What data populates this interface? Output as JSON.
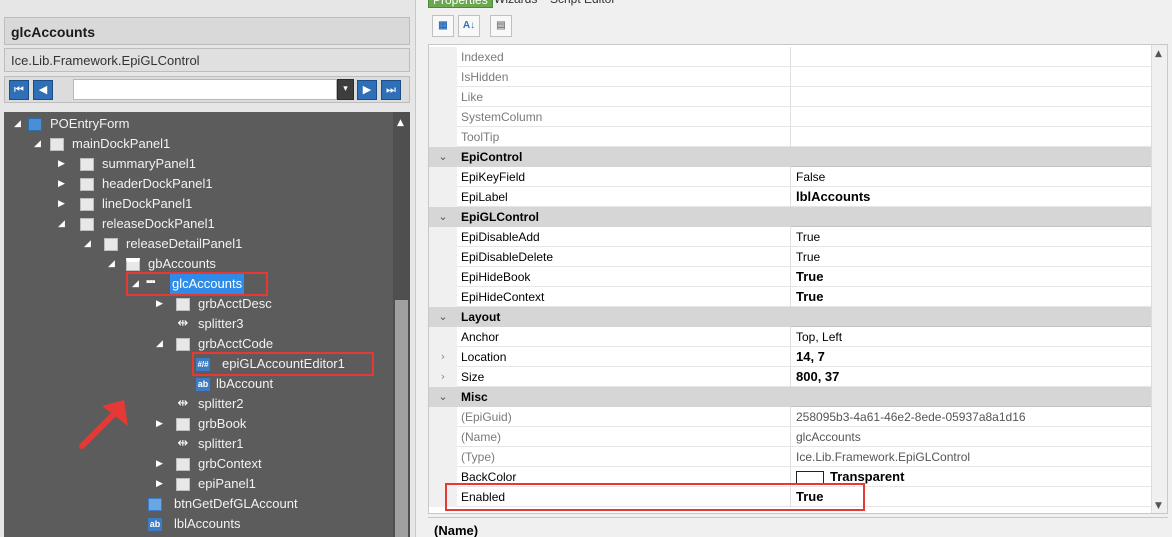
{
  "left": {
    "title": "glcAccounts",
    "type_name": "Ice.Lib.Framework.EpiGLControl",
    "nav": {
      "first": "⏮",
      "prev": "◀",
      "dropdown": "▾",
      "next": "▶",
      "last": "⏭"
    },
    "tree": [
      {
        "label": "POEntryForm",
        "icon": "form-icon"
      },
      {
        "label": "mainDockPanel1",
        "icon": "panel-icon"
      },
      {
        "label": "summaryPanel1",
        "icon": "panel-icon"
      },
      {
        "label": "headerDockPanel1",
        "icon": "panel-icon"
      },
      {
        "label": "lineDockPanel1",
        "icon": "panel-icon"
      },
      {
        "label": "releaseDockPanel1",
        "icon": "panel-icon"
      },
      {
        "label": "releaseDetailPanel1",
        "icon": "panel-icon"
      },
      {
        "label": "gbAccounts",
        "icon": "groupbox-icon"
      },
      {
        "label": "glcAccounts",
        "icon": "gl-control-icon"
      },
      {
        "label": "grbAcctDesc",
        "icon": "panel-icon"
      },
      {
        "label": "splitter3",
        "icon": "splitter-icon"
      },
      {
        "label": "grbAcctCode",
        "icon": "panel-icon"
      },
      {
        "label": "epiGLAccountEditor1",
        "icon": "editor-icon",
        "icon_text": "#/#"
      },
      {
        "label": "lbAccount",
        "icon": "label-icon",
        "icon_text": "ab"
      },
      {
        "label": "splitter2",
        "icon": "splitter-icon"
      },
      {
        "label": "grbBook",
        "icon": "panel-icon"
      },
      {
        "label": "splitter1",
        "icon": "splitter-icon"
      },
      {
        "label": "grbContext",
        "icon": "panel-icon"
      },
      {
        "label": "epiPanel1",
        "icon": "panel-icon"
      },
      {
        "label": "btnGetDefGLAccount",
        "icon": "button-icon"
      },
      {
        "label": "lblAccounts",
        "icon": "label-icon",
        "icon_text": "ab"
      }
    ],
    "selected": "glcAccounts"
  },
  "right": {
    "tabs": {
      "properties": "Properties",
      "wizards": "Wizards",
      "script": "Script Editor"
    },
    "toolbar": {
      "categorized": "▦",
      "alpha": "A↓",
      "pages": "▤"
    },
    "rows": [
      {
        "kind": "prop",
        "name": "Indexed",
        "value": ""
      },
      {
        "kind": "prop",
        "name": "IsHidden",
        "value": ""
      },
      {
        "kind": "prop",
        "name": "Like",
        "value": ""
      },
      {
        "kind": "prop",
        "name": "SystemColumn",
        "value": ""
      },
      {
        "kind": "prop",
        "name": "ToolTip",
        "value": ""
      },
      {
        "kind": "cat",
        "name": "EpiControl"
      },
      {
        "kind": "prop",
        "name": "EpiKeyField",
        "value": "False"
      },
      {
        "kind": "prop",
        "name": "EpiLabel",
        "value": "lblAccounts",
        "bold": true
      },
      {
        "kind": "cat",
        "name": "EpiGLControl"
      },
      {
        "kind": "prop",
        "name": "EpiDisableAdd",
        "value": "True"
      },
      {
        "kind": "prop",
        "name": "EpiDisableDelete",
        "value": "True"
      },
      {
        "kind": "prop",
        "name": "EpiHideBook",
        "value": "True",
        "bold": true
      },
      {
        "kind": "prop",
        "name": "EpiHideContext",
        "value": "True",
        "bold": true
      },
      {
        "kind": "cat",
        "name": "Layout"
      },
      {
        "kind": "prop",
        "name": "Anchor",
        "value": "Top, Left"
      },
      {
        "kind": "prop",
        "name": "Location",
        "value": "14, 7",
        "bold": true,
        "expandable": true
      },
      {
        "kind": "prop",
        "name": "Size",
        "value": "800, 37",
        "bold": true,
        "expandable": true
      },
      {
        "kind": "cat",
        "name": "Misc"
      },
      {
        "kind": "prop",
        "name": "(EpiGuid)",
        "value": "258095b3-4a61-46e2-8ede-05937a8a1d16",
        "readonly": true
      },
      {
        "kind": "prop",
        "name": "(Name)",
        "value": "glcAccounts",
        "readonly": true
      },
      {
        "kind": "prop",
        "name": "(Type)",
        "value": "Ice.Lib.Framework.EpiGLControl",
        "readonly": true
      },
      {
        "kind": "prop",
        "name": "BackColor",
        "value": "Transparent",
        "bold": true,
        "swatch": true
      },
      {
        "kind": "prop",
        "name": "Enabled",
        "value": "True",
        "bold": true
      }
    ],
    "description_title": "(Name)"
  },
  "colors": {
    "tree_bg": "#5c5c5c",
    "selection": "#2f8be8",
    "highlight": "#e53935",
    "properties_tab": "#6aa84f",
    "category_bg": "#d6d6d6"
  }
}
